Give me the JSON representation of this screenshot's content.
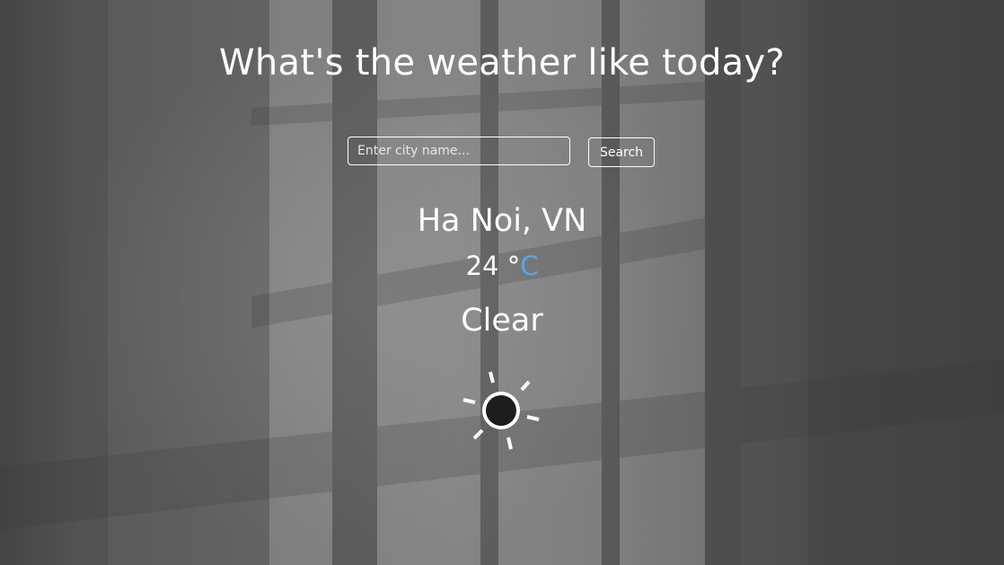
{
  "page": {
    "heading": "What's the weather like today?"
  },
  "search": {
    "placeholder": "Enter city name...",
    "value": "",
    "button_label": "Search"
  },
  "weather": {
    "location": "Ha Noi, VN",
    "temperature": "24",
    "degree_symbol": "°",
    "unit": "C",
    "condition": "Clear",
    "icon": "sun-icon"
  },
  "colors": {
    "text": "#ffffff",
    "unit_accent": "#5aa6e6",
    "background": "#5e5e5e"
  }
}
